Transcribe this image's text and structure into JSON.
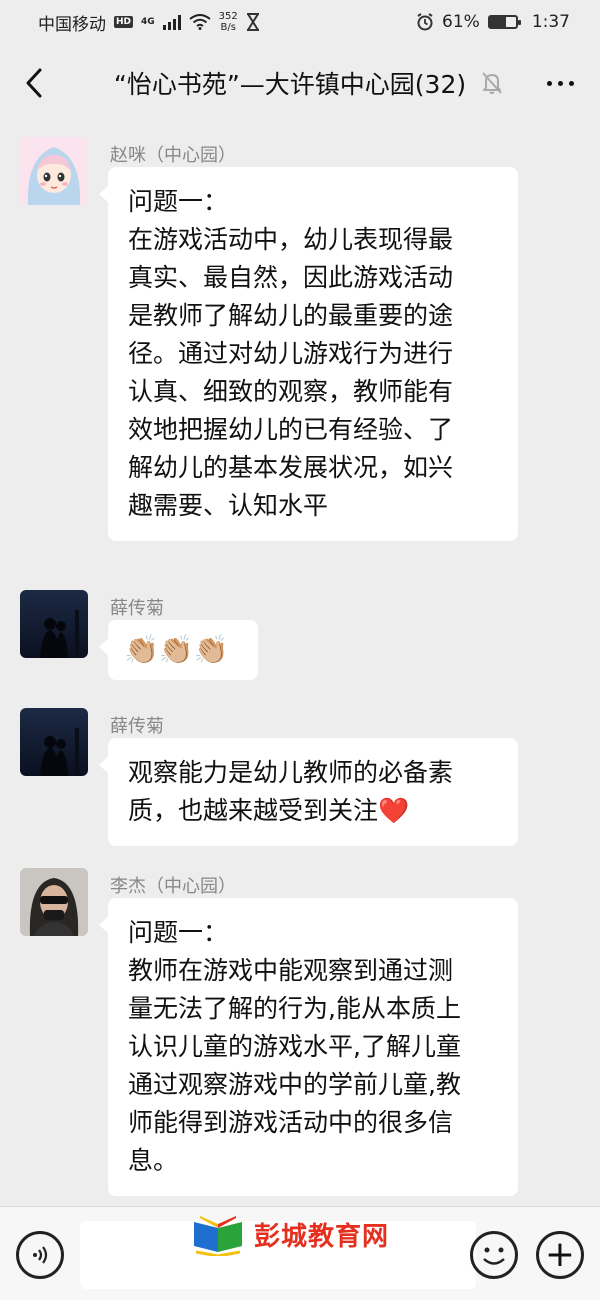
{
  "status_bar": {
    "carrier": "中国移动",
    "hd": "HD",
    "network": "4G",
    "speed_value": "352",
    "speed_unit": "B/s",
    "battery_percent": "61%",
    "battery_level": 0.61,
    "time": "1:37"
  },
  "nav": {
    "title": "“怡心书苑”—大许镇中心园(32)"
  },
  "messages": [
    {
      "sender": "赵咪（中心园）",
      "text": "问题一：\n在游戏活动中，幼儿表现得最\n真实、最自然，因此游戏活动\n是教师了解幼儿的最重要的途\n径。通过对幼儿游戏行为进行\n认真、细致的观察，教师能有\n效地把握幼儿的已有经验、了\n解幼儿的基本发展状况，如兴\n趣需要、认知水平"
    },
    {
      "sender": "薛传菊",
      "text": "👏🏼👏🏼👏🏼"
    },
    {
      "sender": "薛传菊",
      "text": "观察能力是幼儿教师的必备素\n质，也越来越受到关注❤️"
    },
    {
      "sender": "李杰（中心园）",
      "text": "问题一：\n教师在游戏中能观察到通过测\n量无法了解的行为,能从本质上\n认识儿童的游戏水平,了解儿童\n通过观察游戏中的学前儿童,教\n师能得到游戏活动中的很多信\n息。"
    }
  ],
  "input_bar": {
    "watermark": "彭城教育网",
    "plus": "+"
  },
  "colors": {
    "background": "#ededed",
    "bubble": "#ffffff",
    "watermark_red": "#e53020"
  }
}
